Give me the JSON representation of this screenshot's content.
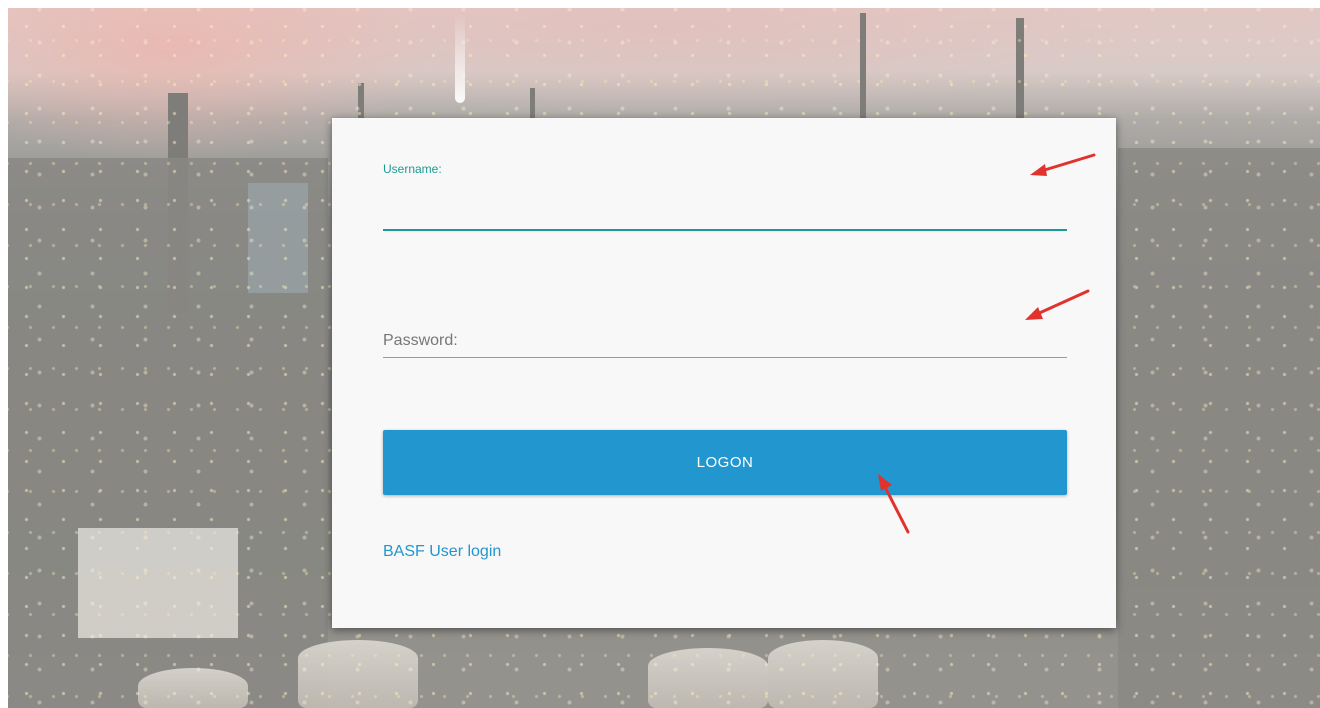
{
  "login": {
    "username_label": "Username:",
    "username_value": "",
    "password_label": "Password:",
    "password_value": "",
    "logon_button": "LOGON",
    "alt_login_link": "BASF User login"
  },
  "annotations": {
    "arrow_color": "#e0332e",
    "arrow_count": 3
  },
  "colors": {
    "accent_teal": "#1b9b95",
    "button_blue": "#2196cf",
    "card_bg": "#f8f8f8"
  }
}
